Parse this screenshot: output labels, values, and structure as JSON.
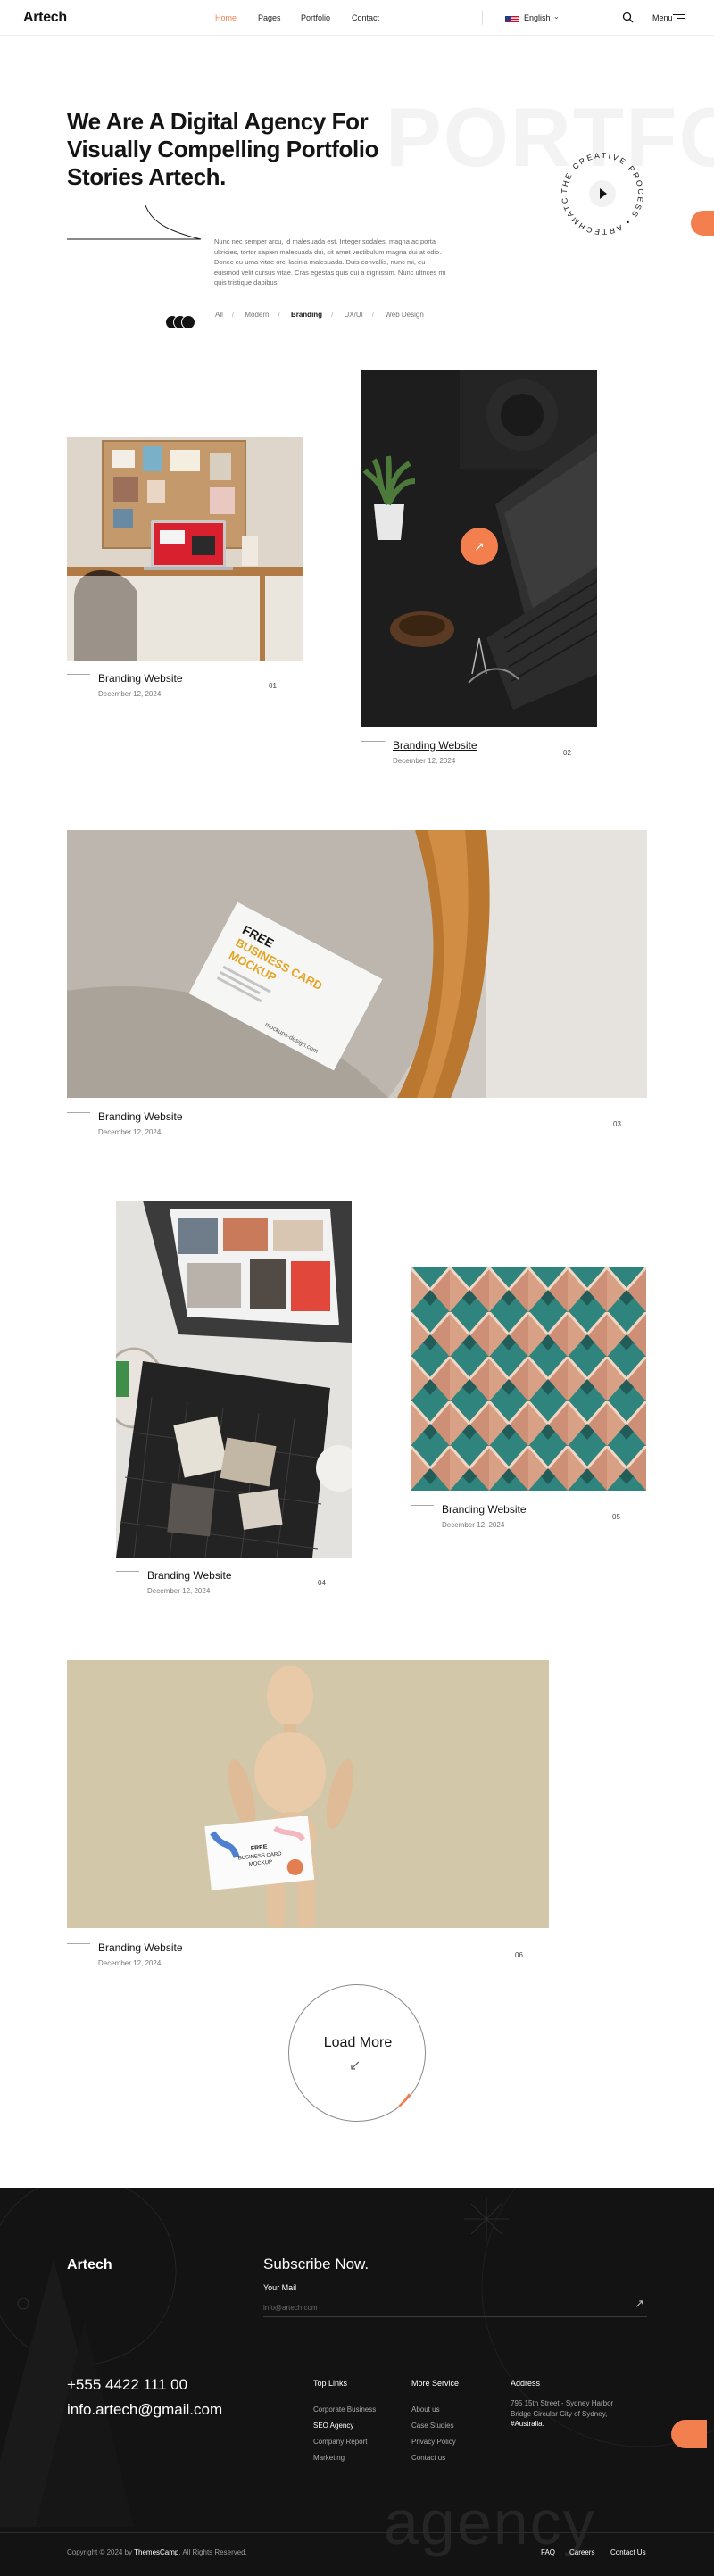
{
  "brand": {
    "logo": "Artech",
    "accent": "#f47f4e"
  },
  "nav": {
    "links": [
      {
        "label": "Home",
        "active": true
      },
      {
        "label": "Pages"
      },
      {
        "label": "Portfolio"
      },
      {
        "label": "Contact"
      }
    ],
    "language": "English",
    "menu_label": "Menu"
  },
  "hero": {
    "title": "We Are A Digital Agency For Visually Compelling Portfolio Stories Artech.",
    "ghost_text": "PORTFO",
    "badge_text": "THE CREATIVE PROCESS • ARTECHMATCH •",
    "description": "Nunc nec semper arcu, id malesuada est. Integer sodales, magna ac porta ultricies, tortor sapien malesuada dui, sit amet vestibulum magna dui at odio. Donec eu urna vitae orci lacinia malesuada. Duis convallis, nunc mi, eu euismod velit cursus vitae. Cras egestas quis dui a dignissim. Nunc ultrices mi quis tristique dapibus.",
    "filters": [
      "All",
      "Modern",
      "Branding",
      "UX/UI",
      "Web Design"
    ],
    "active_filter": "Branding"
  },
  "portfolio": [
    {
      "title": "Branding Website",
      "date": "December 12, 2024",
      "num": "01",
      "image": "desk-workspace"
    },
    {
      "title": "Branding Website",
      "date": "December 12, 2024",
      "num": "02",
      "image": "dark-laptop-plant"
    },
    {
      "title": "Branding Website",
      "date": "December 12, 2024",
      "num": "03",
      "image": "business-card-chair"
    },
    {
      "title": "Branding Website",
      "date": "December 12, 2024",
      "num": "04",
      "image": "magazine-photos"
    },
    {
      "title": "Branding Website",
      "date": "December 12, 2024",
      "num": "05",
      "image": "geometric-pattern"
    },
    {
      "title": "Branding Website",
      "date": "December 12, 2024",
      "num": "06",
      "image": "wooden-mannequin-card"
    }
  ],
  "card_mockup": {
    "line1": "FREE",
    "line2": "BUSINESS CARD",
    "line3": "MOCKUP",
    "url": "mockups-design.com"
  },
  "load_more": "Load More",
  "footer": {
    "logo": "Artech",
    "subscribe_title": "Subscribe Now.",
    "mail_label": "Your Mail",
    "mail_placeholder": "info@artech.com",
    "phone": "+555 4422 111 00",
    "email": "info.artech@gmail.com",
    "top_links": {
      "heading": "Top Links",
      "items": [
        "Corporate Business",
        "SEO Agency",
        "Company Report",
        "Marketing"
      ]
    },
    "more_service": {
      "heading": "More Service",
      "items": [
        "About us",
        "Case Studies",
        "Privacy Policy",
        "Contact us"
      ]
    },
    "address": {
      "heading": "Address",
      "lines": "795 15th Street - Sydney Harbor Bridge Circular City of Sydney,",
      "country": "#Australia."
    },
    "ghost": "agency",
    "copyright_pre": "Copyright © 2024 by ",
    "copyright_brand": "ThemesCamp",
    "copyright_post": ". All Rights Reserved.",
    "bottom_links": [
      "FAQ",
      "Careers",
      "Contact Us"
    ]
  }
}
